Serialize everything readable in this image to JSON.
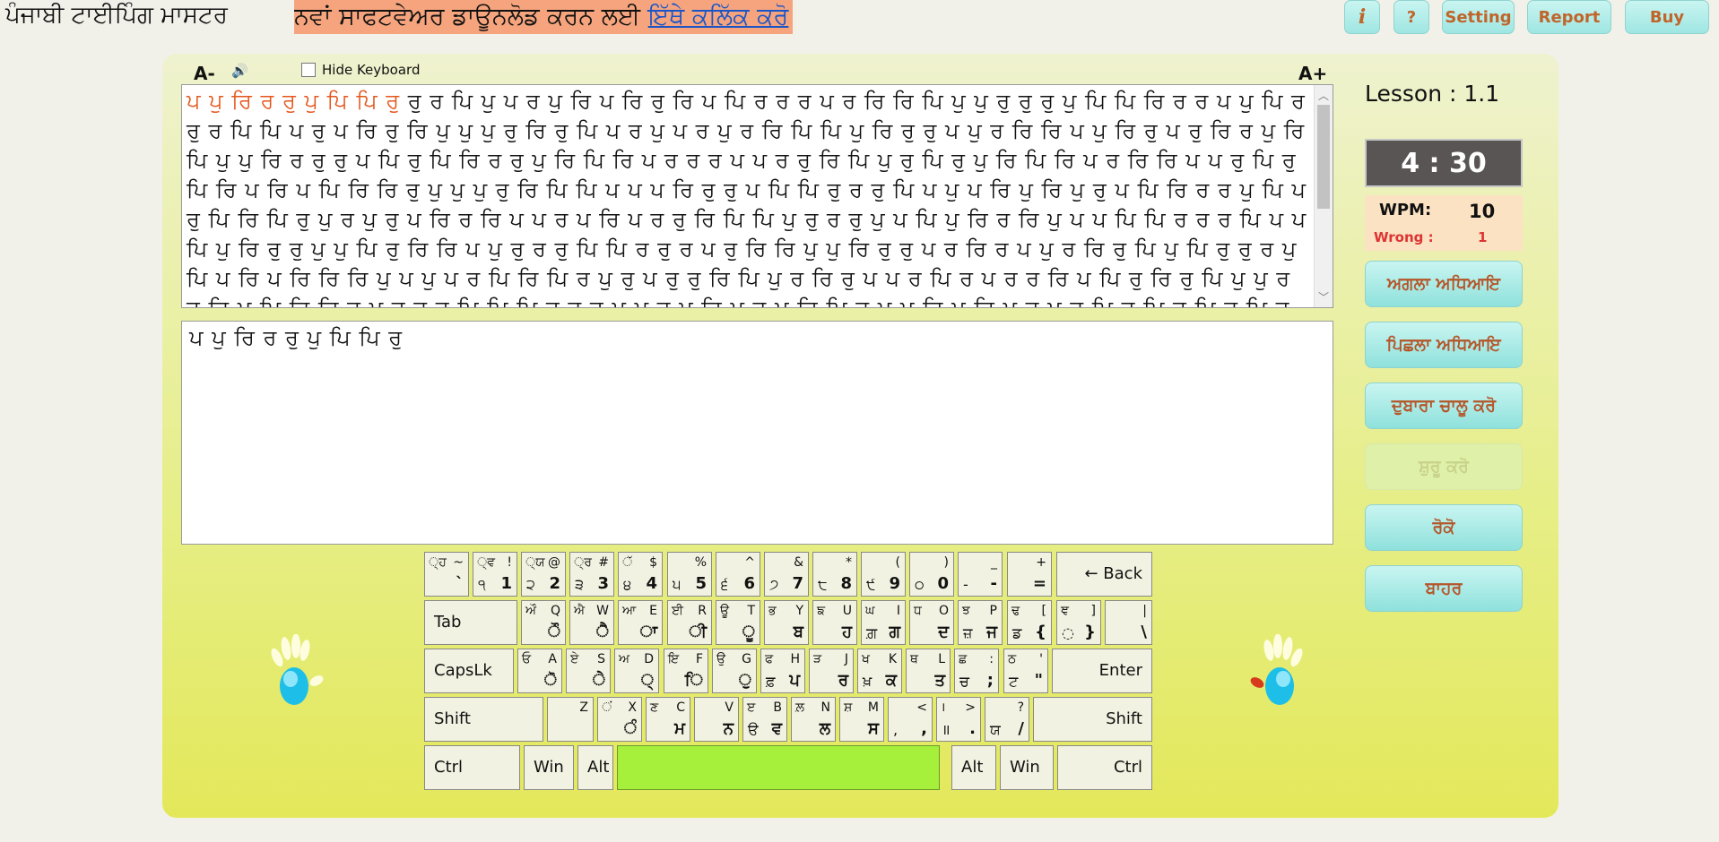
{
  "app": {
    "title": "ਪੰਜਾਬੀ ਟਾਈਪਿੰਗ ਮਾਸਟਰ"
  },
  "banner": {
    "text": "ਨਵਾਂ ਸਾਫਟਵੇਅਰ ਡਾਊਨਲੋਡ ਕਰਨ ਲਈ ",
    "link": "ਇੱਥੇ ਕਲਿੱਕ ਕਰੋ"
  },
  "topbar": {
    "info": "i",
    "help": "?",
    "setting": "Setting",
    "report": "Report",
    "buy": "Buy"
  },
  "controls": {
    "font_smaller": "A-",
    "font_larger": "A+",
    "speaker": "🔊",
    "hide_keyboard": "Hide Keyboard"
  },
  "passage": {
    "done": "ਪ ਪੁ ਰਿ ਰ ਰੁ ਪੁ ਪਿ ਪਿ ਰੁ ",
    "rest": "ਰੁ ਰ ਪਿ ਪੁ ਪ ਰ ਪੁ ਰਿ ਪ ਰਿ ਰੁ ਰਿ ਪ ਪਿ ਰ ਰ ਰ ਪ ਰ ਰਿ ਰਿ ਪਿ ਪੁ ਪੁ ਰੁ ਰੁ ਰੁ ਪੁ ਪਿ ਪਿ ਰਿ ਰ ਰ ਪ ਪੁ ਪਿ ਰ ਰੁ ਰ ਪਿ ਪਿ ਪ ਰੁ ਪ ਰਿ ਰੁ ਰਿ ਪੁ ਪੁ ਪੁ ਰੁ ਰਿ ਰੁ ਪਿ ਪ ਰ ਪੁ ਪ ਰ ਪੁ ਰ ਰਿ ਪਿ ਪਿ ਪੁ ਰਿ ਰੁ ਰੁ ਪ ਪੁ ਰ ਰਿ ਰਿ ਪ ਪੁ ਰਿ ਰੁ ਪ ਰੁ ਰਿ ਰ ਪੁ ਰਿ ਪਿ ਪੁ ਪੁ ਰਿ ਰ ਰੁ ਰੁ ਪ ਪਿ ਰੁ ਪਿ ਰਿ ਰ ਰੁ ਪੁ ਰਿ ਪਿ ਰਿ ਪ ਰ ਰ ਰ ਪ ਪ ਰ ਰੁ ਰਿ ਪਿ ਪੁ ਰੁ ਪਿ ਰੁ ਪੁ ਰਿ ਪਿ ਰਿ ਪ ਰ ਰਿ ਰਿ ਪ ਪ ਰੁ ਪਿ ਰੁ ਪਿ ਰਿ ਪ ਰਿ ਪ ਪਿ ਰਿ ਰਿ ਰੁ ਪੁ ਪੁ ਪੁ ਰੁ ਰਿ ਪਿ ਪਿ ਪ ਪ ਪ ਰਿ ਰੁ ਰੁ ਪ ਪਿ ਪਿ ਰੁ ਰ ਰੁ ਪਿ ਪ ਪੁ ਪ ਰਿ ਪੁ ਰਿ ਪੁ ਰੁ ਪ ਪਿ ਰਿ ਰ ਰ ਪੁ ਪਿ ਪ ਰੁ ਪਿ ਰਿ ਪਿ ਰੁ ਪੁ ਰ ਪੁ ਰੁ ਪ ਰਿ ਰ ਰਿ ਪ ਪ ਰ ਪ ਰਿ ਪ ਰ ਰੁ ਰਿ ਪਿ ਪਿ ਪੁ ਰੁ ਰ ਰੁ ਪੁ ਪ ਪਿ ਪੁ ਰਿ ਰ ਰਿ ਪੁ ਪ ਪ ਪਿ ਪਿ ਰ ਰ ਰ ਪਿ ਪ ਪ ਪਿ ਪੁ ਰਿ ਰੁ ਰੁ ਪੁ ਪੁ ਪਿ ਰੁ ਰਿ ਰਿ ਪ ਪੁ ਰੁ ਰ ਰੁ ਪਿ ਪਿ ਰ ਰੁ ਰ ਪ ਰੁ ਰਿ ਰਿ ਪੁ ਪੁ ਰਿ ਰੁ ਰੁ ਪ ਰ ਰਿ ਰ ਪ ਪੁ ਰ ਰਿ ਰੁ ਪਿ ਪੁ ਪਿ ਰੁ ਰੁ ਰ ਪੁ ਪਿ ਪ ਰਿ ਪ ਰਿ ਰਿ ਰਿ ਪੁ ਪ ਪੁ ਪ ਰ ਪਿ ਰਿ ਪਿ ਰ ਪੁ ਰੁ ਪ ਰੁ ਰੁ ਰਿ ਪਿ ਪੁ ਰ ਰਿ ਰੁ ਪ ਪ ਰ ਪਿ ਰ ਪ ਰ ਰ ਰਿ ਪ ਪਿ ਰੁ ਰਿ ਰੁ ਪਿ ਪੁ ਪੁ ਰ ਰੁ ਰਿ ਪ ਪਿ ਰਿ ਰਿ ਰ ਪ ਰੁ ਰੁ ਰ ਪਿ ਪਿ ਪਿ ਰ ਰ ਰੁ ਪ ਪ ਰੁ ਪੁ ਰਿ ਪੁ ਰੁ ਪੁ ਰਿ ਪਿ ਰੁ ਪ ਪ ਰਿ ਪ ਰਿ ਪੁ ਰ ਪੁ ਰੁ ਪਿ ਰੁ ਪਿ ਰੁ ਪਿ ਰੁ ਪਿ ਰ ਪੁ ਪਿ ਰ ਪੁ ਰੁ ਰਿ ਪ ਪਿ ਰਿ ਰ ਪੁ ਰ ਰੁ ਪਿ ਪਿ ਰ ਰੁ ਪ ਰ ਪਿ ਰ ਪ ਪ ਰਿ ਪਿ ਰਿ ਰਿ ਪ ਪਿ ਪਿ ਪ ਪ ਰੁ ਪਿ ਪ ਰ ਪ ਰੁ ਪ ਪਿ ਰਿ ਰਿ ਪ ਪਿ ਪ ਪ"
  },
  "typed": "ਪ ਪੁ ਰਿ ਰ ਰੁ ਪੁ ਪਿ ਪਿ ਰੁ",
  "sidebar": {
    "lesson": "Lesson : 1.1",
    "timer": "4 : 30",
    "wpm_label": "WPM:",
    "wpm": "10",
    "wrong_label": "Wrong :",
    "wrong": "1",
    "next": "ਅਗਲਾ ਅਧਿਆਇ",
    "prev": "ਪਿਛਲਾ ਅਧਿਆਇ",
    "restart": "ਦੁਬਾਰਾ ਚਾਲੂ ਕਰੋ",
    "start": "ਸ਼ੁਰੂ ਕਰੋ",
    "stop": "ਰੋਕੋ",
    "exit": "ਬਾਹਰ"
  },
  "keyboard": {
    "rows": [
      [
        {
          "tl": "◌੍ਹ",
          "tr": "~",
          "bl": "",
          "br": "`"
        },
        {
          "tl": "◌੍ਵ",
          "tr": "!",
          "bl": "੧",
          "br": "1"
        },
        {
          "tl": "◌੍ਯ",
          "tr": "@",
          "bl": "੨",
          "br": "2"
        },
        {
          "tl": "◌੍ਰ",
          "tr": "#",
          "bl": "੩",
          "br": "3"
        },
        {
          "tl": "◌ੱ",
          "tr": "$",
          "bl": "੪",
          "br": "4"
        },
        {
          "tl": "",
          "tr": "%",
          "bl": "੫",
          "br": "5"
        },
        {
          "tl": "",
          "tr": "^",
          "bl": "੬",
          "br": "6"
        },
        {
          "tl": "",
          "tr": "&",
          "bl": "੭",
          "br": "7"
        },
        {
          "tl": "",
          "tr": "*",
          "bl": "੮",
          "br": "8"
        },
        {
          "tl": "",
          "tr": "(",
          "bl": "੯",
          "br": "9"
        },
        {
          "tl": "",
          "tr": ")",
          "bl": "੦",
          "br": "0"
        },
        {
          "tl": "",
          "tr": "_",
          "bl": "-",
          "br": "-"
        },
        {
          "tl": "",
          "tr": "+",
          "bl": "",
          "br": "="
        },
        {
          "label": "← Back"
        }
      ],
      [
        {
          "label": "Tab"
        },
        {
          "tl": "ਔ",
          "tr": "Q",
          "bl": "",
          "br": "ੌ"
        },
        {
          "tl": "ਐ",
          "tr": "W",
          "bl": "",
          "br": "ੈ"
        },
        {
          "tl": "ਆ",
          "tr": "E",
          "bl": "",
          "br": "ਾ"
        },
        {
          "tl": "ਈ",
          "tr": "R",
          "bl": "",
          "br": "ੀ"
        },
        {
          "tl": "ਊ",
          "tr": "T",
          "bl": "",
          "br": "ੂ"
        },
        {
          "tl": "ਭ",
          "tr": "Y",
          "bl": "",
          "br": "ਬ"
        },
        {
          "tl": "ਙ",
          "tr": "U",
          "bl": "",
          "br": "ਹ"
        },
        {
          "tl": "ਘ",
          "tr": "I",
          "bl": "ਗ਼",
          "br": "ਗ"
        },
        {
          "tl": "ਧ",
          "tr": "O",
          "bl": "",
          "br": "ਦ"
        },
        {
          "tl": "ਝ",
          "tr": "P",
          "bl": "ਜ਼",
          "br": "ਜ"
        },
        {
          "tl": "ਢ",
          "tr": "[",
          "bl": "ਡ",
          "br": "{"
        },
        {
          "tl": "ਞ",
          "tr": "]",
          "bl": "◌",
          "br": "}"
        },
        {
          "tl": "",
          "tr": "|",
          "bl": "",
          "br": "\\"
        }
      ],
      [
        {
          "label": "CapsLk"
        },
        {
          "tl": "ਓ",
          "tr": "A",
          "bl": "",
          "br": "ੋ"
        },
        {
          "tl": "ਏ",
          "tr": "S",
          "bl": "",
          "br": "ੇ"
        },
        {
          "tl": "ਅ",
          "tr": "D",
          "bl": "",
          "br": "੍"
        },
        {
          "tl": "ਇ",
          "tr": "F",
          "bl": "",
          "br": "ਿ"
        },
        {
          "tl": "ਉ",
          "tr": "G",
          "bl": "",
          "br": "ੁ"
        },
        {
          "tl": "ਫ",
          "tr": "H",
          "bl": "ਫ਼",
          "br": "ਪ"
        },
        {
          "tl": "ੜ",
          "tr": "J",
          "bl": "",
          "br": "ਰ"
        },
        {
          "tl": "ਖ",
          "tr": "K",
          "bl": "ਖ਼",
          "br": "ਕ"
        },
        {
          "tl": "ਥ",
          "tr": "L",
          "bl": "",
          "br": "ਤ"
        },
        {
          "tl": "ਛ",
          "tr": ":",
          "bl": "ਚ",
          "br": ";"
        },
        {
          "tl": "ਠ",
          "tr": "'",
          "bl": "ਟ",
          "br": "\""
        },
        {
          "label": "Enter"
        }
      ],
      [
        {
          "label": "Shift"
        },
        {
          "tl": "",
          "tr": "Z",
          "bl": "",
          "br": ""
        },
        {
          "tl": "◌ਂ",
          "tr": "X",
          "bl": "",
          "br": "ੰ"
        },
        {
          "tl": "ਣ",
          "tr": "C",
          "bl": "",
          "br": "ਮ"
        },
        {
          "tl": "",
          "tr": "V",
          "bl": "",
          "br": "ਨ"
        },
        {
          "tl": "ੲ",
          "tr": "B",
          "bl": "ੳ",
          "br": "ਵ"
        },
        {
          "tl": "ਲ਼",
          "tr": "N",
          "bl": "",
          "br": "ਲ"
        },
        {
          "tl": "ਸ਼",
          "tr": "M",
          "bl": "",
          "br": "ਸ"
        },
        {
          "tl": "",
          "tr": "<",
          "bl": ",",
          "br": ","
        },
        {
          "tl": "।",
          "tr": ">",
          "bl": "॥",
          "br": "."
        },
        {
          "tl": "",
          "tr": "?",
          "bl": "ਯ",
          "br": "/"
        },
        {
          "label": "Shift"
        }
      ],
      [
        {
          "label": "Ctrl"
        },
        {
          "label": "Win"
        },
        {
          "label": "Alt"
        },
        {
          "label": ""
        },
        {
          "label": "Alt"
        },
        {
          "label": "Win"
        },
        {
          "label": "Ctrl"
        }
      ]
    ]
  },
  "colors": {
    "accent": "#e4561d",
    "banner": "#f5a47d",
    "button": "#9fe6e2",
    "space": "#a6f03c"
  }
}
